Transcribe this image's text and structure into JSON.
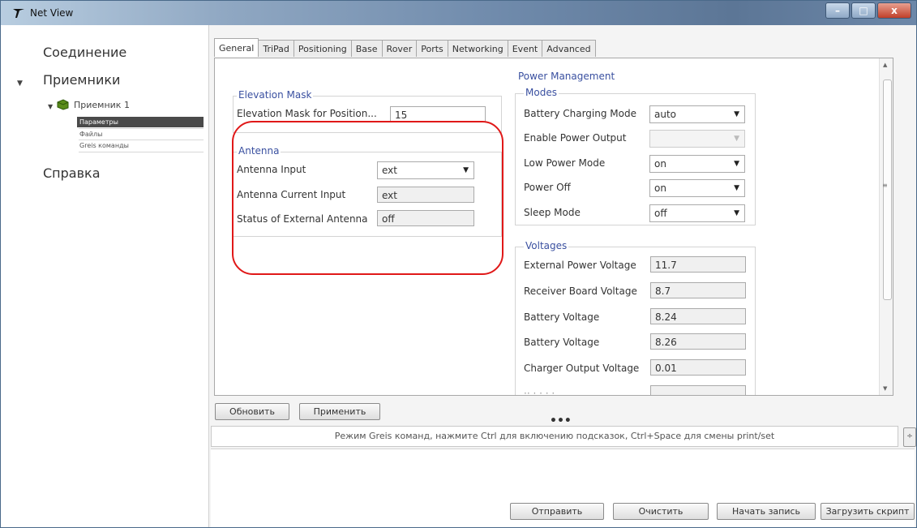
{
  "window": {
    "title": "Net View",
    "buttons": {
      "minimize": "–",
      "maximize": "□",
      "close": "x"
    }
  },
  "sidebar": {
    "connection": "Соединение",
    "receivers": "Приемники",
    "receiver_1": "Приемник 1",
    "params": "Параметры",
    "files": "Файлы",
    "greis": "Greis команды",
    "help": "Справка"
  },
  "tabs": [
    {
      "label": "General",
      "active": true
    },
    {
      "label": "TriPad"
    },
    {
      "label": "Positioning"
    },
    {
      "label": "Base"
    },
    {
      "label": "Rover"
    },
    {
      "label": "Ports"
    },
    {
      "label": "Networking"
    },
    {
      "label": "Event"
    },
    {
      "label": "Advanced"
    }
  ],
  "elevation": {
    "title": "Elevation Mask",
    "label": "Elevation Mask for Position...",
    "value": "15"
  },
  "antenna": {
    "title": "Antenna",
    "input_label": "Antenna Input",
    "input_value": "ext",
    "current_label": "Antenna Current Input",
    "current_value": "ext",
    "status_label": "Status of External Antenna",
    "status_value": "off"
  },
  "power": {
    "title": "Power Management",
    "modes_title": "Modes",
    "charging_label": "Battery Charging Mode",
    "charging_value": "auto",
    "enable_output_label": "Enable Power Output",
    "enable_output_value": "",
    "low_power_label": "Low Power Mode",
    "low_power_value": "on",
    "power_off_label": "Power Off",
    "power_off_value": "on",
    "sleep_label": "Sleep Mode",
    "sleep_value": "off"
  },
  "voltages": {
    "title": "Voltages",
    "external_label": "External Power Voltage",
    "external_value": "11.7",
    "board_label": "Receiver Board Voltage",
    "board_value": "8.7",
    "battery1_label": "Battery Voltage",
    "battery1_value": "8.24",
    "battery2_label": "Battery Voltage",
    "battery2_value": "8.26",
    "charger_label": "Charger Output Voltage",
    "charger_value": "0.01"
  },
  "buttons": {
    "refresh": "Обновить",
    "apply": "Применить",
    "send": "Отправить",
    "clear": "Очистить",
    "start_record": "Начать запись",
    "load_script": "Загрузить скрипт"
  },
  "splitter": "•••",
  "command_hint": "Режим Greis команд, нажмите  Ctrl для включению подсказок, Ctrl+Space для смены print/set",
  "icons": {
    "app_logo": "app-logo-icon",
    "expand": "▼",
    "collapse": "▼",
    "dropdown": "▼",
    "scroll_up": "▲",
    "scroll_down": "▼",
    "scroll_grip": "≡",
    "cmd_side": "÷"
  },
  "colors": {
    "accent_label": "#3a50a0",
    "highlight_oval": "#e01818",
    "selected_item": "#4a4a4a"
  }
}
